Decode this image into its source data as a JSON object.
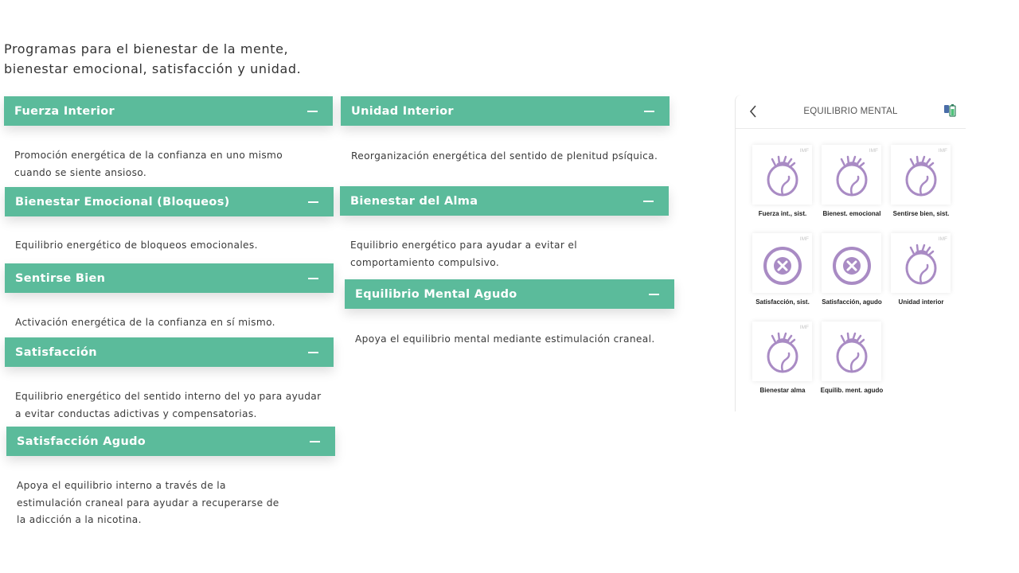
{
  "intro": "Programas para el bienestar de la mente,\nbienestar emocional, satisfacción y unidad.",
  "programs_left": [
    {
      "title": "Fuerza Interior",
      "desc": "Promoción energética de la confianza en uno mismo cuando se siente ansioso."
    },
    {
      "title": "Bienestar Emocional (Bloqueos)",
      "desc": "Equilibrio energético de bloqueos emocionales."
    },
    {
      "title": "Sentirse Bien",
      "desc": "Activación energética de la confianza en sí mismo."
    },
    {
      "title": "Satisfacción",
      "desc": "Equilibrio energético del sentido interno del yo para ayudar a evitar conductas adictivas y compensatorias."
    },
    {
      "title": "Satisfacción Agudo",
      "desc": "Apoya el equilibrio interno a través de la estimulación craneal para ayudar a recuperarse de la adicción a la nicotina."
    }
  ],
  "programs_right": [
    {
      "title": "Unidad Interior",
      "desc": "Reorganización energética del sentido de plenitud psíquica."
    },
    {
      "title": "Bienestar del Alma",
      "desc": "Equilibrio energético para ayudar a evitar el comportamiento compulsivo."
    },
    {
      "title": "Equilibrio Mental Agudo",
      "desc": "Apoya el equilibrio mental mediante estimulación craneal."
    }
  ],
  "phone": {
    "title": "EQUILIBRIO MENTAL",
    "back_icon": "chevron-left-icon",
    "status_icon": "battery-icon",
    "tile_badge": "IMF",
    "accent_color": "#a98bc4",
    "tiles": [
      {
        "label": "Fuerza int., sist.",
        "icon": "head-icon",
        "badge": true
      },
      {
        "label": "Bienest. emocional",
        "icon": "head-icon",
        "badge": true
      },
      {
        "label": "Sentirse bien, sist.",
        "icon": "head-icon",
        "badge": true
      },
      {
        "label": "Satisfacción, sist.",
        "icon": "no-symbol-icon",
        "badge": true
      },
      {
        "label": "Satisfacción, agudo",
        "icon": "no-symbol-icon",
        "badge": false
      },
      {
        "label": "Unidad interior",
        "icon": "head-icon",
        "badge": true
      },
      {
        "label": "Bienestar alma",
        "icon": "head-icon",
        "badge": true
      },
      {
        "label": "Equilib. ment. agudo",
        "icon": "head-icon",
        "badge": false
      }
    ]
  },
  "colors": {
    "accent_green": "#5bbb9b",
    "icon_purple": "#a98bc4"
  }
}
